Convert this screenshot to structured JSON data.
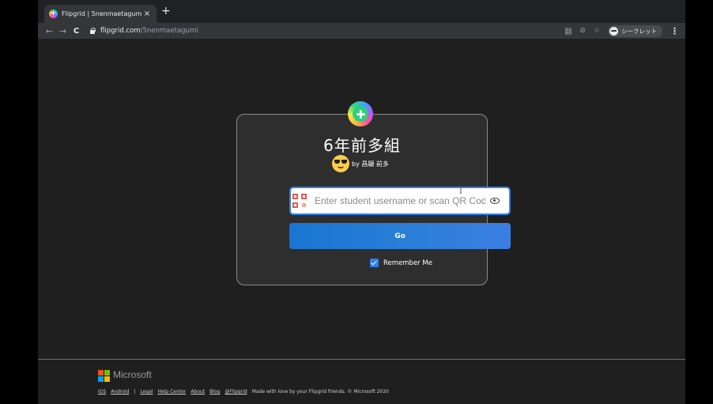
{
  "browser": {
    "tab_title": "Flipgrid | 5nenmaetagumi",
    "tab_close": "×",
    "new_tab": "+",
    "url_host": "flipgrid.com",
    "url_path": "/5nenmaetagumi",
    "profile_label": "シークレット",
    "nav": {
      "back": "←",
      "forward": "→",
      "reload": "C"
    },
    "icons": [
      "translate-icon",
      "eye-off-icon",
      "star-icon",
      "profile-icon",
      "menu-icon"
    ],
    "translate_glyph": "翻",
    "eye_off_glyph": "⊘",
    "star_glyph": "☆",
    "menu_glyph": "⋮"
  },
  "card": {
    "title": "6年前多組",
    "owner_text": "by 昌顯 前多",
    "login_placeholder": "Enter student username or scan QR Code",
    "go_label": "Go",
    "remember_label": "Remember Me",
    "remember_checked": true,
    "cursor_glyph": "I"
  },
  "footer": {
    "brand": "Microsoft",
    "links": [
      "iOS",
      "Android",
      "Legal",
      "Help Center",
      "About",
      "Blog",
      "@Flipgrid"
    ],
    "separator": "|",
    "tagline": "Made with love by your Flipgrid friends. © Microsoft 2020"
  },
  "colors": {
    "background": "#1f1f1f",
    "card": "#2e2e2e",
    "accent": "#2f80ed",
    "button": "#1976d2"
  }
}
